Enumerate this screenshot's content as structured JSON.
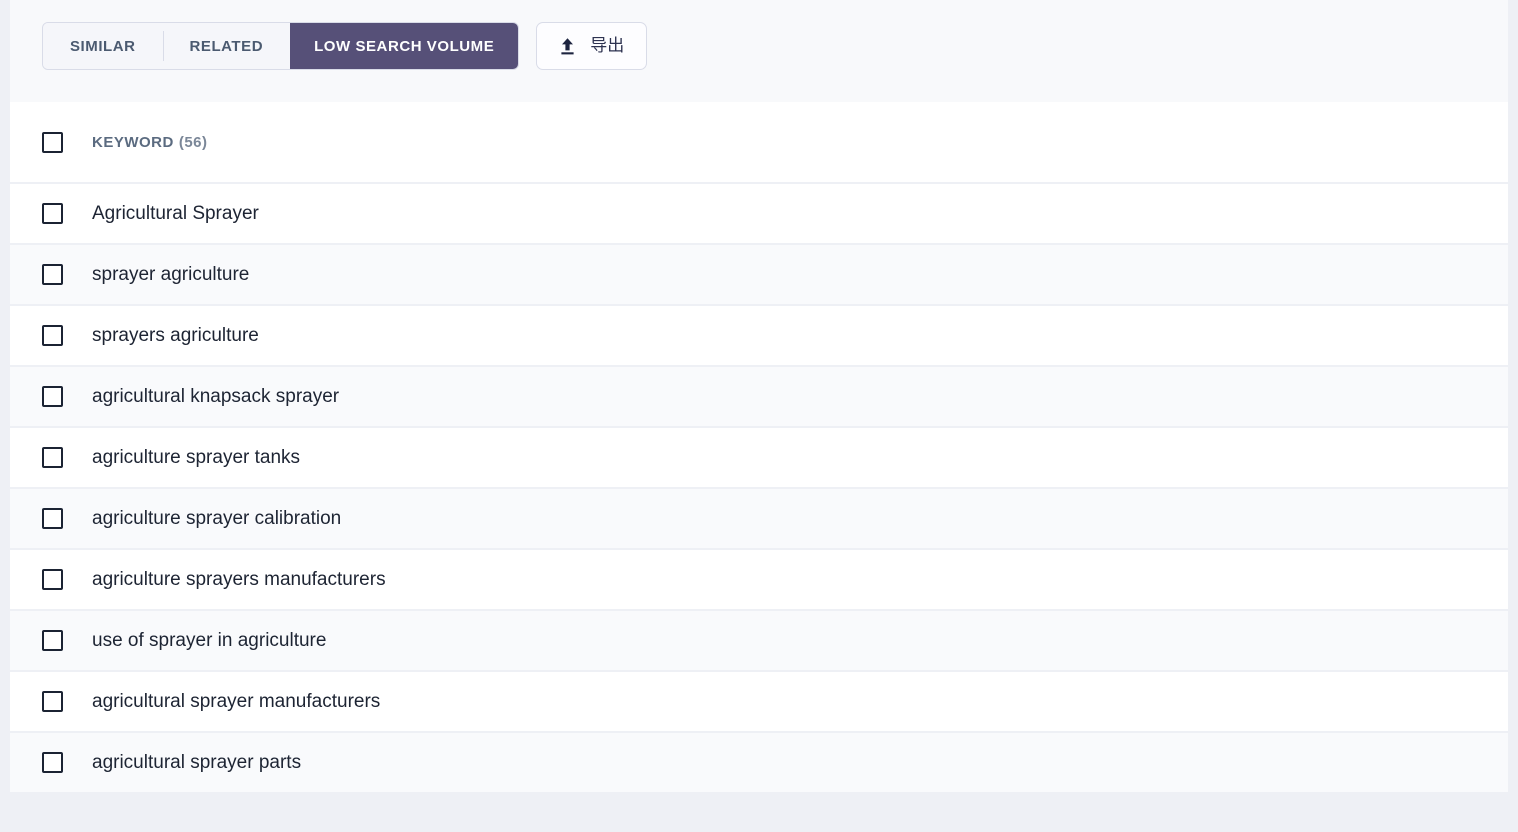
{
  "toolbar": {
    "tabs": [
      {
        "label": "SIMILAR",
        "active": false
      },
      {
        "label": "RELATED",
        "active": false
      },
      {
        "label": "LOW SEARCH VOLUME",
        "active": true
      }
    ],
    "export_button": {
      "label": "导出",
      "icon": "upload-icon"
    },
    "active_tab_color": "#565078",
    "border_color": "#d9dce8"
  },
  "list": {
    "header": {
      "label": "KEYWORD",
      "count": "(56)"
    },
    "rows": [
      {
        "keyword": "Agricultural Sprayer"
      },
      {
        "keyword": "sprayer agriculture"
      },
      {
        "keyword": "sprayers agriculture"
      },
      {
        "keyword": "agricultural knapsack sprayer"
      },
      {
        "keyword": "agriculture sprayer tanks"
      },
      {
        "keyword": "agriculture sprayer calibration"
      },
      {
        "keyword": "agriculture sprayers manufacturers"
      },
      {
        "keyword": "use of sprayer in agriculture"
      },
      {
        "keyword": "agricultural sprayer manufacturers"
      },
      {
        "keyword": "agricultural sprayer parts"
      }
    ]
  }
}
